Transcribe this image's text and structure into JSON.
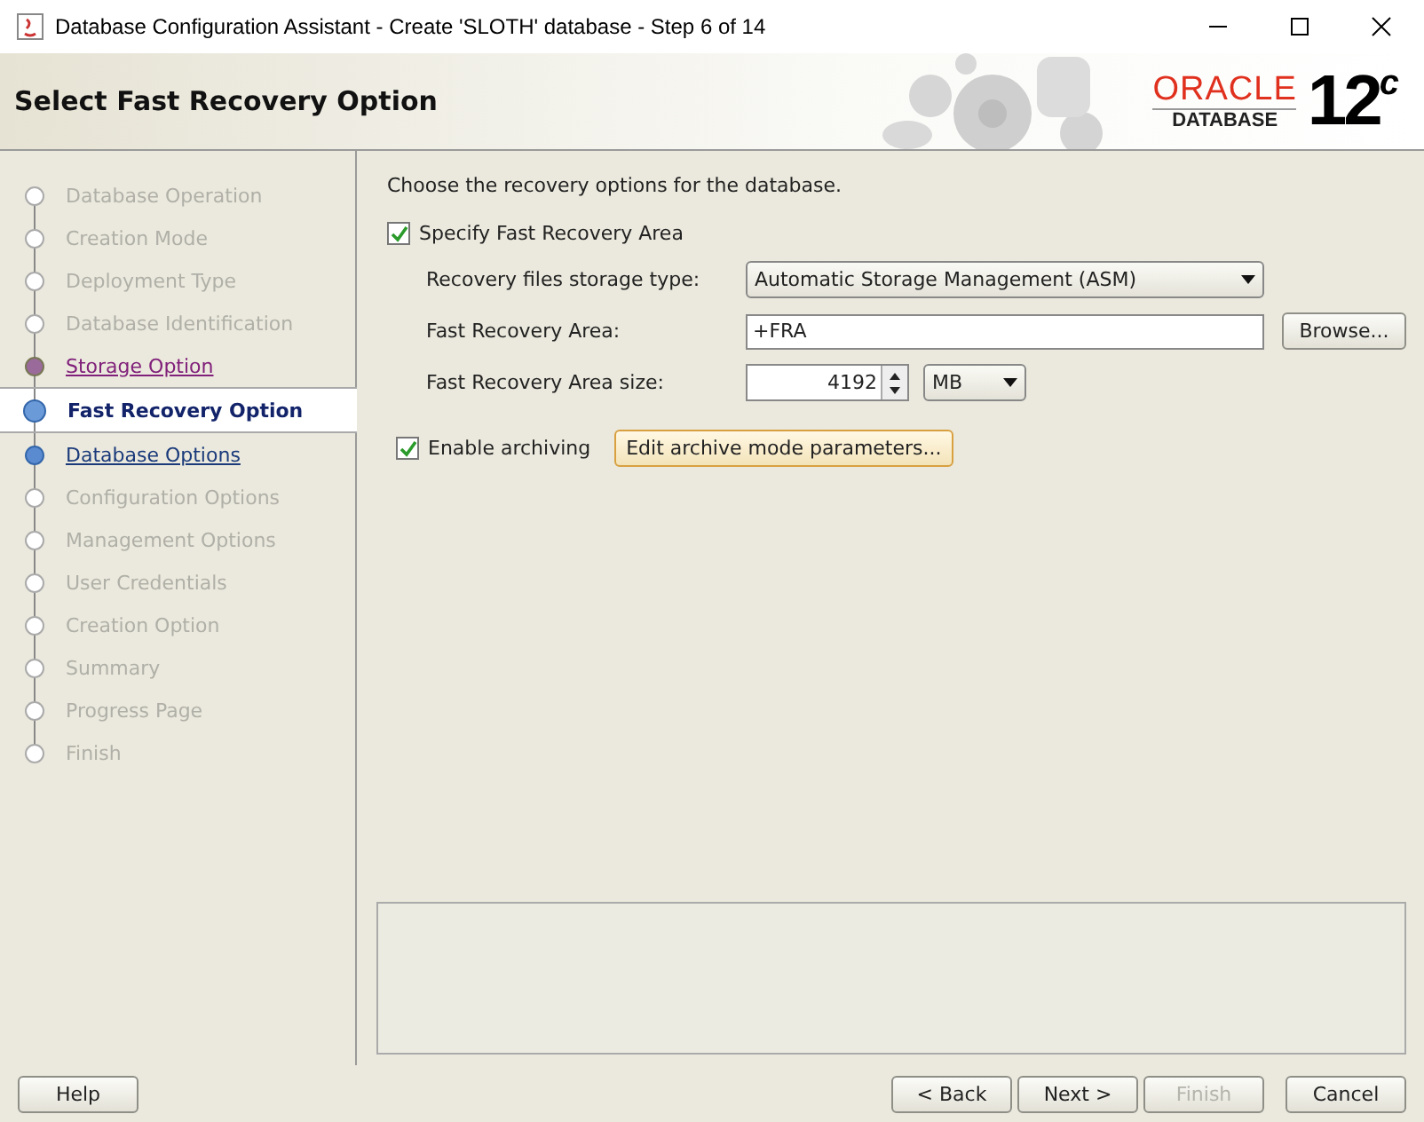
{
  "window": {
    "title": "Database Configuration Assistant - Create 'SLOTH' database - Step 6 of 14"
  },
  "header": {
    "title": "Select Fast Recovery Option",
    "logo": {
      "brand": "ORACLE",
      "product": "DATABASE",
      "version": "12",
      "version_suffix": "c"
    }
  },
  "steps": [
    {
      "label": "Database Operation",
      "kind": "disabled",
      "selected": false
    },
    {
      "label": "Creation Mode",
      "kind": "disabled",
      "selected": false
    },
    {
      "label": "Deployment Type",
      "kind": "disabled",
      "selected": false
    },
    {
      "label": "Database Identification",
      "kind": "disabled",
      "selected": false
    },
    {
      "label": "Storage Option",
      "kind": "visited",
      "selected": false
    },
    {
      "label": "Fast Recovery Option",
      "kind": "current",
      "selected": true
    },
    {
      "label": "Database Options",
      "kind": "link",
      "selected": false
    },
    {
      "label": "Configuration Options",
      "kind": "disabled",
      "selected": false
    },
    {
      "label": "Management Options",
      "kind": "disabled",
      "selected": false
    },
    {
      "label": "User Credentials",
      "kind": "disabled",
      "selected": false
    },
    {
      "label": "Creation Option",
      "kind": "disabled",
      "selected": false
    },
    {
      "label": "Summary",
      "kind": "disabled",
      "selected": false
    },
    {
      "label": "Progress Page",
      "kind": "disabled",
      "selected": false
    },
    {
      "label": "Finish",
      "kind": "disabled",
      "selected": false
    }
  ],
  "content": {
    "intro": "Choose the recovery options for the database.",
    "specify_fra": {
      "label": "Specify Fast Recovery Area",
      "checked": true
    },
    "storage_type": {
      "label": "Recovery files storage type:",
      "value": "Automatic Storage Management (ASM)"
    },
    "fra_location": {
      "label": "Fast Recovery Area:",
      "value": "+FRA",
      "button": "Browse..."
    },
    "fra_size": {
      "label": "Fast Recovery Area size:",
      "value": "4192",
      "unit": "MB"
    },
    "archiving": {
      "label": "Enable archiving",
      "checked": true,
      "button": "Edit archive mode parameters..."
    }
  },
  "buttons": [
    {
      "label": "Help",
      "disabled": false
    },
    {
      "label": "< Back",
      "disabled": false
    },
    {
      "label": "Next >",
      "disabled": false
    },
    {
      "label": "Finish",
      "disabled": true
    },
    {
      "label": "Cancel",
      "disabled": false
    }
  ]
}
